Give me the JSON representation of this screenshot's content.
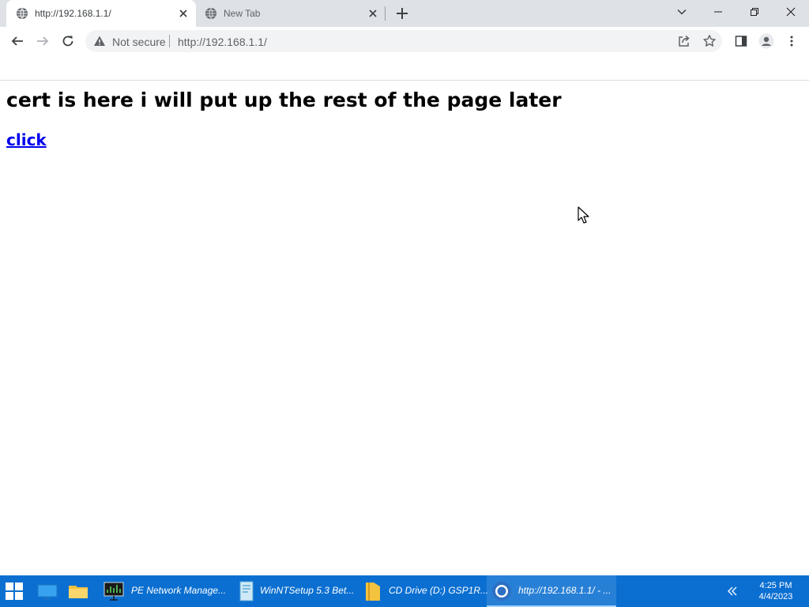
{
  "browser": {
    "tabs": [
      {
        "title": "http://192.168.1.1/",
        "active": true
      },
      {
        "title": "New Tab",
        "active": false
      }
    ],
    "omnibox": {
      "security_label": "Not secure",
      "url": "http://192.168.1.1/"
    }
  },
  "page": {
    "heading": "cert is here i will put up the rest of the page later",
    "link_text": "click"
  },
  "taskbar": {
    "items": [
      {
        "label": "PE Network Manage..."
      },
      {
        "label": "WinNTSetup 5.3 Bet..."
      },
      {
        "label": "CD Drive (D:) GSP1R..."
      },
      {
        "label": "http://192.168.1.1/ - ..."
      }
    ],
    "clock": {
      "time": "4:25 PM",
      "date": "4/4/2023"
    }
  },
  "colors": {
    "tabstrip": "#dee1e6",
    "taskbar": "#0b6fd1",
    "link": "#0000ee"
  }
}
